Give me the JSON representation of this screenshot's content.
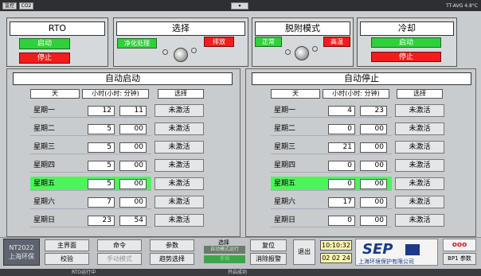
{
  "titlebar": {
    "btn1": "监控",
    "btn2": "CO2",
    "right": "TT-AVG  4.8°C"
  },
  "sections": {
    "rto": {
      "title": "RTO",
      "start": "启动",
      "stop": "停止"
    },
    "select": {
      "title": "选择",
      "left": "净化处理",
      "right": "排放"
    },
    "desorb": {
      "title": "脱附模式",
      "left": "正常",
      "right": "高温"
    },
    "cool": {
      "title": "冷却",
      "start": "启动",
      "stop": "停止"
    }
  },
  "auto_start": {
    "title": "自动启动",
    "headers": [
      "天",
      "小时(小时: 分钟)",
      "选择"
    ],
    "rows": [
      {
        "day": "星期一",
        "h": "12",
        "m": "11",
        "action": "未激活"
      },
      {
        "day": "星期二",
        "h": "5",
        "m": "00",
        "action": "未激活"
      },
      {
        "day": "星期三",
        "h": "5",
        "m": "00",
        "action": "未激活"
      },
      {
        "day": "星期四",
        "h": "5",
        "m": "00",
        "action": "未激活"
      },
      {
        "day": "星期五",
        "h": "5",
        "m": "00",
        "action": "未激活"
      },
      {
        "day": "星期六",
        "h": "7",
        "m": "00",
        "action": "未激活"
      },
      {
        "day": "星期日",
        "h": "23",
        "m": "54",
        "action": "未激活"
      }
    ]
  },
  "auto_stop": {
    "title": "自动停止",
    "headers": [
      "天",
      "小时(小时: 分钟)",
      "选择"
    ],
    "rows": [
      {
        "day": "星期一",
        "h": "4",
        "m": "23",
        "action": "未激活"
      },
      {
        "day": "星期二",
        "h": "0",
        "m": "00",
        "action": "未激活"
      },
      {
        "day": "星期三",
        "h": "21",
        "m": "00",
        "action": "未激活"
      },
      {
        "day": "星期四",
        "h": "0",
        "m": "00",
        "action": "未激活"
      },
      {
        "day": "星期五",
        "h": "0",
        "m": "00",
        "action": "未激活"
      },
      {
        "day": "星期六",
        "h": "17",
        "m": "00",
        "action": "未激活"
      },
      {
        "day": "星期日",
        "h": "0",
        "m": "00",
        "action": "未激活"
      }
    ]
  },
  "bottom": {
    "info1": "NT2022",
    "info2": "上海环保",
    "main": "主界面",
    "command": "命令",
    "params": "参数",
    "calib": "校验",
    "manual": "手动模式",
    "trend": "趋势选择",
    "select_lbl": "选择",
    "mode_on": "自动模式运行",
    "mode_state": "手动",
    "reset": "复位",
    "alarm": "消除报警",
    "exit": "退出",
    "time": "10:10:32",
    "date": "02 02 24",
    "logo": "SEP",
    "company": "上海环境保护有限公司",
    "bp_param": "BP1 参数"
  },
  "statusbar": {
    "left": "RTO运行中",
    "mid": "开启成功"
  }
}
